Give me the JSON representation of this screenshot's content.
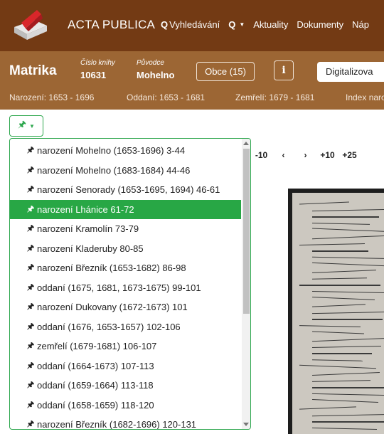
{
  "navbar": {
    "brand": "ACTA PUBLICA",
    "links": [
      {
        "icon": "search-icon",
        "glyph": "Q",
        "label": "Vyhledávání"
      },
      {
        "icon": "search-icon",
        "glyph": "Q",
        "label": "",
        "caret": "▼"
      },
      {
        "label": "Aktuality"
      },
      {
        "label": "Dokumenty"
      },
      {
        "label": "Náp"
      }
    ]
  },
  "book": {
    "title": "Matrika",
    "cislo_label": "Číslo knihy",
    "cislo_value": "10631",
    "puvod_label": "Původce",
    "puvod_value": "Mohelno",
    "obce_button": "Obce (15)",
    "info_button": "i",
    "digi_button": "Digitalizova",
    "ranges": [
      "Narození: 1653 - 1696",
      "Oddaní: 1653 - 1681",
      "Zemřelí: 1679 - 1681",
      "Index naro"
    ]
  },
  "pin_button": {
    "icon": "pin-icon",
    "glyph": "🖈",
    "caret": "▼"
  },
  "pager": [
    "-10",
    "‹",
    "›",
    "+10",
    "+25"
  ],
  "dropdown": {
    "active_index": 3,
    "items": [
      "narození Mohelno (1653-1696) 3-44",
      "narození Mohelno (1683-1684) 44-46",
      "narození Senorady (1653-1695, 1694) 46-61",
      "narození Lhánice 61-72",
      "narození Kramolín 73-79",
      "narození Kladeruby 80-85",
      "narození Březník (1653-1682) 86-98",
      "oddaní (1675, 1681, 1673-1675) 99-101",
      "narození Dukovany (1672-1673) 101",
      "oddaní (1676, 1653-1657) 102-106",
      "zemřelí (1679-1681) 106-107",
      "oddaní (1664-1673) 107-113",
      "oddaní (1659-1664) 113-118",
      "oddaní (1658-1659) 118-120",
      "narození Březník (1682-1696) 120-131"
    ]
  }
}
